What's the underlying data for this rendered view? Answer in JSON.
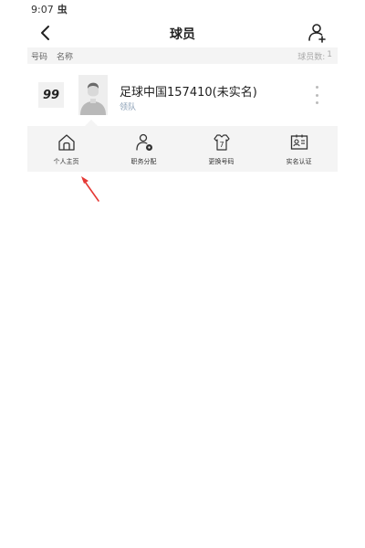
{
  "status_bar": {
    "time": "9:07",
    "indicator": "虫"
  },
  "nav": {
    "title": "球员",
    "back_icon": "chevron-left-icon",
    "add_icon": "add-user-icon"
  },
  "table_header": {
    "col_number": "号码",
    "col_name": "名称",
    "count_label": "球员数:",
    "count_value": "1"
  },
  "player": {
    "number": "99",
    "name": "足球中国157410(未实名)",
    "role": "领队",
    "avatar_icon": "avatar-placeholder",
    "more_icon": "more-vertical-icon"
  },
  "actions": [
    {
      "label": "个人主页",
      "icon": "home-icon"
    },
    {
      "label": "职务分配",
      "icon": "assign-role-icon"
    },
    {
      "label": "更换号码",
      "icon": "change-number-icon"
    },
    {
      "label": "实名认证",
      "icon": "id-card-icon"
    }
  ],
  "colors": {
    "accent_arrow": "#e53935",
    "role_text": "#8a9fb5",
    "panel_bg": "#f4f4f4"
  }
}
